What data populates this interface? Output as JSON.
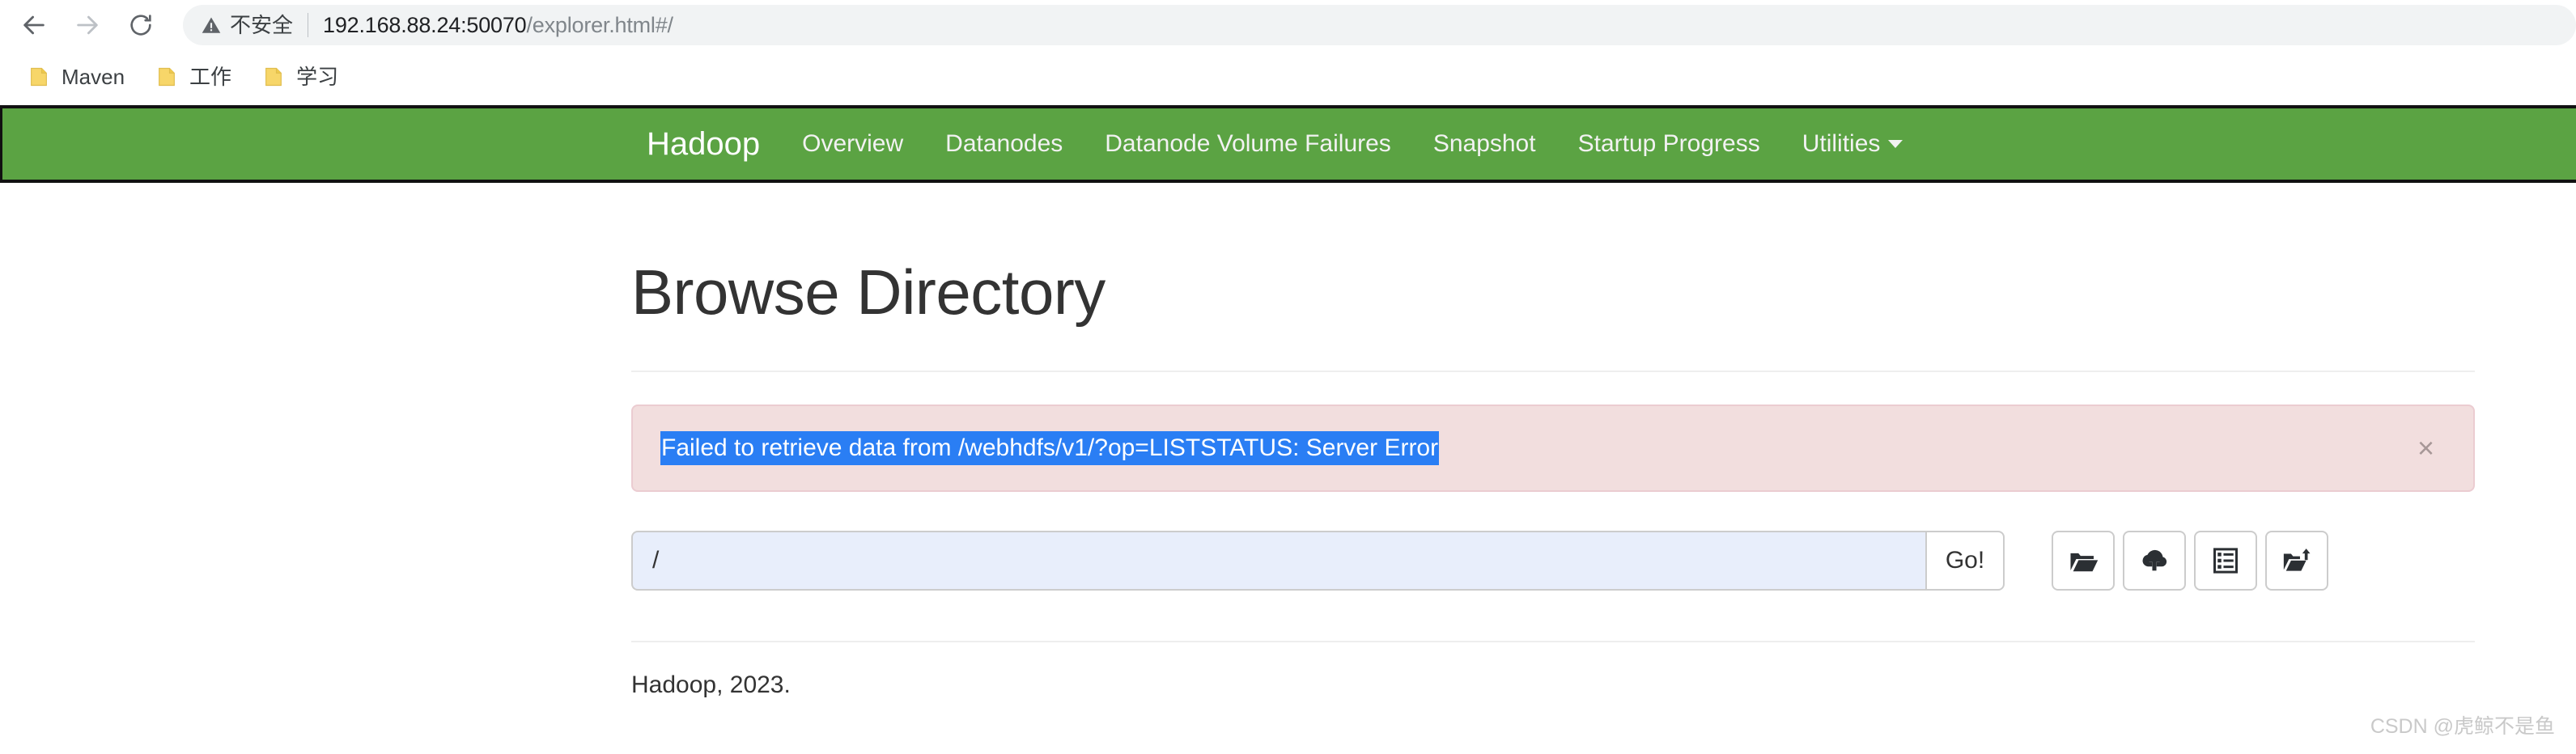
{
  "browser": {
    "back_icon": "arrow-left-icon",
    "forward_icon": "arrow-right-icon",
    "reload_icon": "reload-icon",
    "security_icon": "warning-triangle-icon",
    "security_label": "不安全",
    "url_host": "192.168.88.24:50070",
    "url_path": "/explorer.html#/",
    "url_full": "192.168.88.24:50070/explorer.html#/",
    "bookmarks": [
      {
        "label": "Maven",
        "icon": "folder-icon"
      },
      {
        "label": "工作",
        "icon": "folder-icon"
      },
      {
        "label": "学习",
        "icon": "folder-icon"
      }
    ]
  },
  "navbar": {
    "brand": "Hadoop",
    "background_color": "#5ba343",
    "links": [
      {
        "label": "Overview",
        "caret": false
      },
      {
        "label": "Datanodes",
        "caret": false
      },
      {
        "label": "Datanode Volume Failures",
        "caret": false
      },
      {
        "label": "Snapshot",
        "caret": false
      },
      {
        "label": "Startup Progress",
        "caret": false
      },
      {
        "label": "Utilities",
        "caret": true
      }
    ]
  },
  "main": {
    "page_title": "Browse Directory",
    "alert": {
      "message": "Failed to retrieve data from /webhdfs/v1/?op=LISTSTATUS: Server Error",
      "close_label": "×",
      "background_color": "#f2dede",
      "border_color": "#ebccd1",
      "selection_color": "#2a7ef4",
      "text_selected": true
    },
    "path_form": {
      "input_value": "/",
      "input_placeholder": "",
      "go_label": "Go!",
      "input_background_color": "#e8eefb"
    },
    "file_actions": [
      {
        "icon": "open-folder-icon",
        "name": "browse-directory-button"
      },
      {
        "icon": "cloud-upload-icon",
        "name": "upload-file-button"
      },
      {
        "icon": "clipboard-list-icon",
        "name": "file-list-button"
      },
      {
        "icon": "folder-upload-icon",
        "name": "cut-paste-button"
      }
    ]
  },
  "footer": {
    "text": "Hadoop, 2023."
  },
  "watermark": {
    "text": "CSDN @虎鲸不是鱼"
  }
}
